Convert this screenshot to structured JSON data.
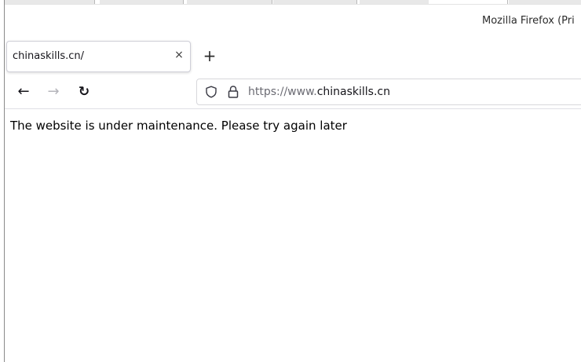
{
  "window": {
    "title": "Mozilla Firefox (Pri"
  },
  "tabs": [
    {
      "label": "chinaskills.cn/",
      "close_symbol": "×"
    }
  ],
  "new_tab_symbol": "+",
  "nav": {
    "back_symbol": "←",
    "forward_symbol": "→",
    "reload_symbol": "↻"
  },
  "urlbar": {
    "prefix": "https://www.",
    "domain": "chinaskills.cn",
    "icons": [
      "shield-icon",
      "lock-icon"
    ]
  },
  "page": {
    "message": "The website is under maintenance. Please try again later"
  }
}
